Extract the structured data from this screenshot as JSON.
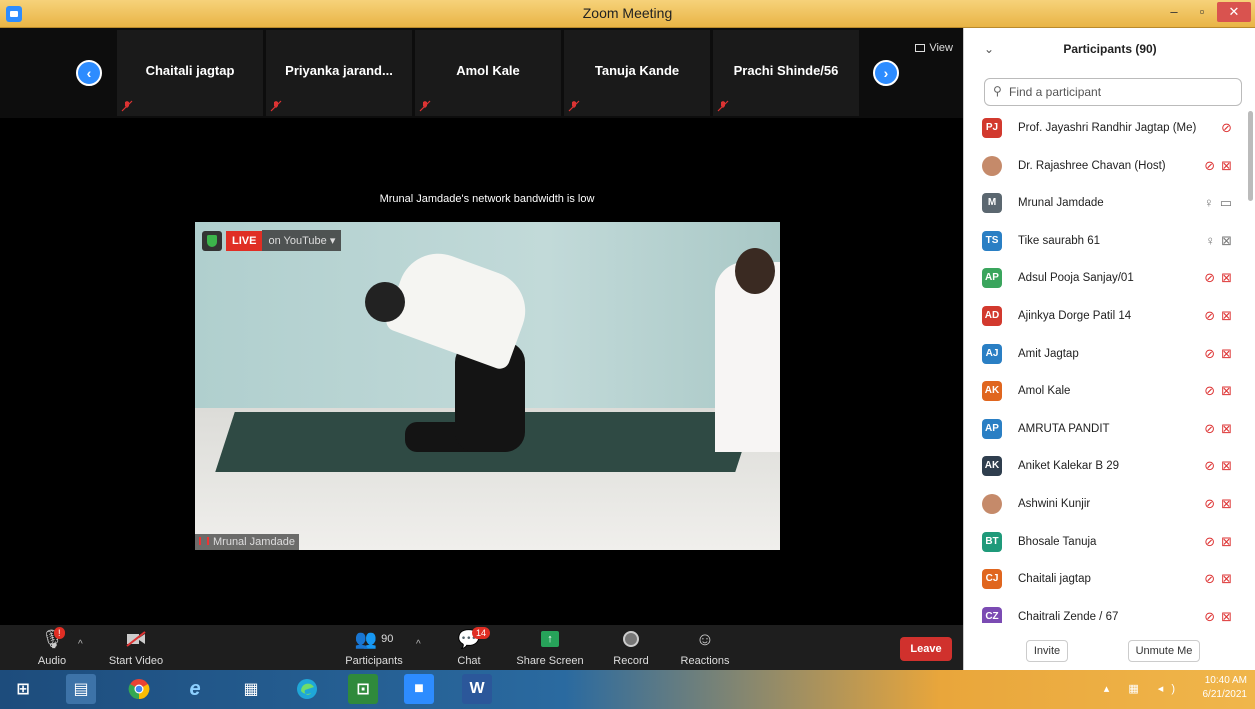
{
  "window": {
    "title": "Zoom Meeting"
  },
  "gallery": {
    "view_label": "View",
    "thumbnails": [
      {
        "name": "Chaitali jagtap"
      },
      {
        "name": "Priyanka  jarand..."
      },
      {
        "name": "Amol Kale"
      },
      {
        "name": "Tanuja Kande"
      },
      {
        "name": "Prachi Shinde/56"
      }
    ]
  },
  "main_video": {
    "notice": "Mrunal Jamdade's network bandwidth is low",
    "live_label": "LIVE",
    "live_platform": "on YouTube",
    "speaker_name": "Mrunal Jamdade"
  },
  "toolbar": {
    "audio": "Audio",
    "audio_badge": "!",
    "start_video": "Start Video",
    "participants": "Participants",
    "participants_count": "90",
    "chat": "Chat",
    "chat_badge": "14",
    "share_screen": "Share Screen",
    "record": "Record",
    "reactions": "Reactions",
    "leave": "Leave"
  },
  "participants_panel": {
    "title": "Participants (90)",
    "search_placeholder": "Find a participant",
    "invite": "Invite",
    "unmute_me": "Unmute Me",
    "list": [
      {
        "initials": "PJ",
        "color": "#d2392e",
        "name": "Prof. Jayashri Randhir Jagtap (Me)",
        "icons": "mic-muted"
      },
      {
        "initials": "",
        "color": "#c58a6a",
        "name": "Dr. Rajashree Chavan (Host)",
        "icons": "mic-muted video-off"
      },
      {
        "initials": "M",
        "color": "#5b6770",
        "name": "Mrunal Jamdade",
        "icons": "mic-on video-on"
      },
      {
        "initials": "TS",
        "color": "#2a7fc4",
        "name": "Tike saurabh 61",
        "icons": "mic-on video-off"
      },
      {
        "initials": "AP",
        "color": "#3aa55d",
        "name": "Adsul Pooja Sanjay/01",
        "icons": "mic-muted video-off"
      },
      {
        "initials": "AD",
        "color": "#d2392e",
        "name": "Ajinkya Dorge Patil 14",
        "icons": "mic-muted video-off"
      },
      {
        "initials": "AJ",
        "color": "#2a7fc4",
        "name": "Amit Jagtap",
        "icons": "mic-muted video-off"
      },
      {
        "initials": "AK",
        "color": "#e0661f",
        "name": "Amol Kale",
        "icons": "mic-muted video-off"
      },
      {
        "initials": "AP",
        "color": "#2a7fc4",
        "name": "AMRUTA PANDIT",
        "icons": "mic-muted video-off"
      },
      {
        "initials": "AK",
        "color": "#2f3e4e",
        "name": "Aniket Kalekar B 29",
        "icons": "mic-muted video-off"
      },
      {
        "initials": "",
        "color": "#c58a6a",
        "name": "Ashwini Kunjir",
        "icons": "mic-muted video-off"
      },
      {
        "initials": "BT",
        "color": "#1f9a7a",
        "name": "Bhosale Tanuja",
        "icons": "mic-muted video-off"
      },
      {
        "initials": "CJ",
        "color": "#e0661f",
        "name": "Chaitali jagtap",
        "icons": "mic-muted video-off"
      },
      {
        "initials": "CZ",
        "color": "#7b4bb3",
        "name": "Chaitrali Zende / 67",
        "icons": "mic-muted video-off"
      }
    ]
  },
  "taskbar": {
    "time": "10:40 AM",
    "date": "6/21/2021"
  }
}
